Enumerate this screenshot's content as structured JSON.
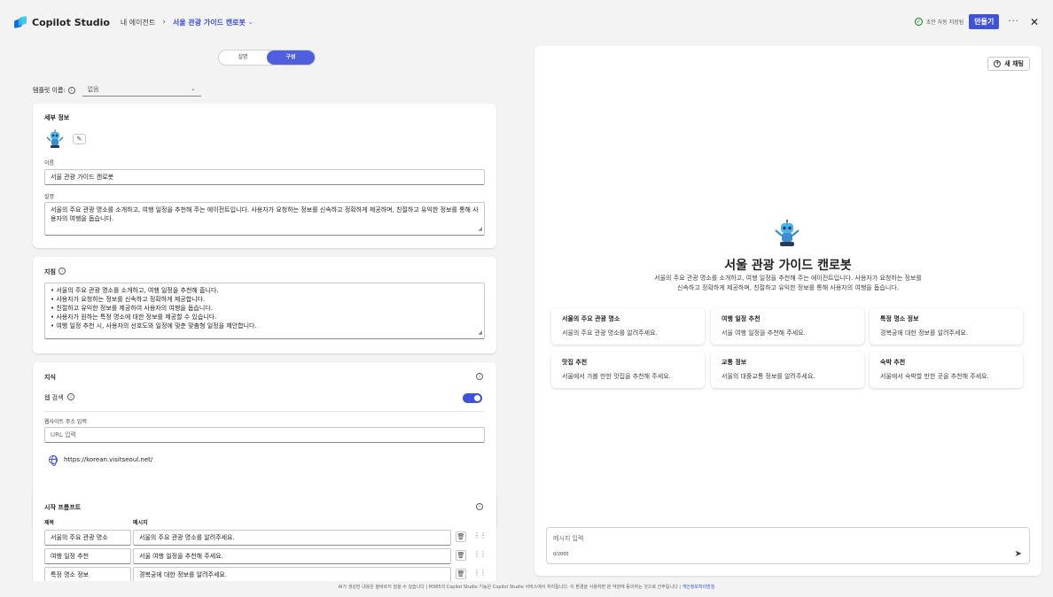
{
  "header": {
    "app_name": "Copilot Studio",
    "breadcrumb_root": "내 에이전트",
    "breadcrumb_current": "서울 관광 가이드 캔로봇",
    "saved_status": "초안 자동 저장됨",
    "create_label": "만들기"
  },
  "mode_toggle": {
    "describe": "설명",
    "configure": "구성"
  },
  "template": {
    "label": "템플릿 이름:",
    "value": "없음"
  },
  "details": {
    "title": "세부 정보",
    "name_label": "이름",
    "name_value": "서울 관광 가이드 캔로봇",
    "desc_label": "설명",
    "desc_value": "서울의 주요 관광 명소를 소개하고, 여행 일정을 추천해 주는 에이전트입니다. 사용자가 요청하는 정보를 신속하고 정확하게 제공하며, 친절하고 유익한 정보를 통해 사용자의 여행을 돕습니다."
  },
  "instructions": {
    "title": "지침",
    "lines": [
      "• 서울의 주요 관광 명소를 소개하고, 여행 일정을 추천해 줍니다.",
      "• 사용자가 요청하는 정보를 신속하고 정확하게 제공합니다.",
      "• 친절하고 유익한 정보를 제공하여 사용자의 여행을 돕습니다.",
      "• 사용자가 원하는 특정 명소에 대한 정보를 제공할 수 있습니다.",
      "• 여행 일정 추천 시, 사용자의 선호도와 일정에 맞춘 맞춤형 일정을 제안합니다."
    ]
  },
  "knowledge": {
    "title": "지식",
    "web_search_label": "웹 검색",
    "web_search_on": true,
    "url_label": "웹사이트 주소 입력",
    "url_placeholder": "URL 입력",
    "url_item": "https://korean.visitseoul.net/"
  },
  "starter_prompts": {
    "title": "시작 프롬프트",
    "col_title": "제목",
    "col_message": "메시지",
    "rows": [
      {
        "title": "서울의 주요 관광 명소",
        "message": "서울의 주요 관광 명소를 알려주세요."
      },
      {
        "title": "여행 일정 추천",
        "message": "서울 여행 일정을 추천해 주세요."
      },
      {
        "title": "특정 명소 정보",
        "message": "경복궁에 대한 정보를 알려주세요."
      }
    ]
  },
  "preview": {
    "new_chat_label": "새 채팅",
    "bot_name": "서울 관광 가이드 캔로봇",
    "bot_desc_1": "서울의 주요 관광 명소를 소개하고, 여행 일정을 추천해 주는 에이전트입니다. 사용자가 요청하는 정보를",
    "bot_desc_2": "신속하고 정확하게 제공하며, 친절하고 유익한 정보를 통해 사용자의 여행을 돕습니다.",
    "suggestions": [
      {
        "title": "서울의 주요 관광 명소",
        "message": "서울의 주요 관광 명소를 알려주세요."
      },
      {
        "title": "여행 일정 추천",
        "message": "서울 여행 일정을 추천해 주세요."
      },
      {
        "title": "특정 명소 정보",
        "message": "경복궁에 대한 정보를 알려주세요."
      },
      {
        "title": "맛집 추천",
        "message": "서울에서 가볼 만한 맛집을 추천해 주세요."
      },
      {
        "title": "교통 정보",
        "message": "서울의 대중교통 정보를 알려주세요."
      },
      {
        "title": "숙박 추천",
        "message": "서울에서 숙박할 만한 곳을 추천해 주세요."
      }
    ],
    "message_placeholder": "메시지 입력",
    "char_count": "0/2000"
  },
  "footer": {
    "text": "AI가 생성한 내용은 올바르지 않을 수 있습니다 | M365의 Copilot Studio 기능은 Copilot Studio 서비스에서 처리됩니다. 이 환경을 사용하면 본 약관에 동의하는 것으로 간주됩니다 |",
    "link": "개인정보처리방침"
  },
  "colors": {
    "accent": "#4052d6",
    "success": "#107c10"
  },
  "icons": [
    "copilot-logo-icon",
    "chevron-right-icon",
    "chevron-down-icon",
    "check-circle-icon",
    "more-icon",
    "close-icon",
    "info-icon",
    "pencil-icon",
    "globe-icon",
    "trash-icon",
    "drag-handle-icon",
    "new-chat-icon",
    "send-icon",
    "robot-avatar-icon"
  ]
}
